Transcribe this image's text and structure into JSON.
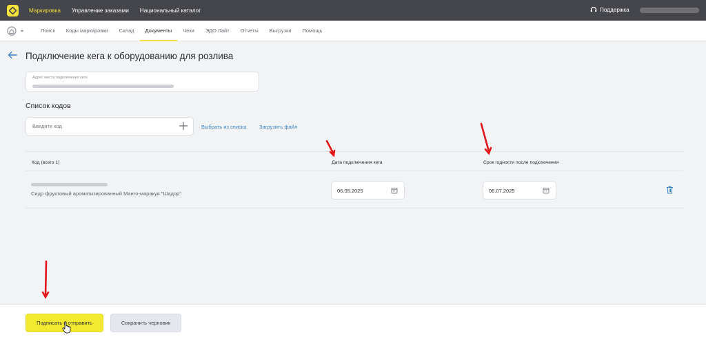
{
  "header": {
    "nav": [
      "Маркировка",
      "Управление заказами",
      "Национальный каталог"
    ],
    "support_label": "Поддержка"
  },
  "subnav": {
    "tabs": [
      "Поиск",
      "Коды маркировки",
      "Склад",
      "Документы",
      "Чеки",
      "ЭДО Лайт",
      "Отчеты",
      "Выгрузки",
      "Помощь"
    ],
    "active_tab": "Документы"
  },
  "page": {
    "title": "Подключение кега к оборудованию для розлива"
  },
  "address": {
    "label": "Адрес места подключения кега"
  },
  "codes": {
    "section_title": "Список кодов",
    "input_placeholder": "Введите код",
    "select_link": "Выбрать из списка",
    "upload_link": "Загрузить файл"
  },
  "table": {
    "columns": [
      "Код (всего 1)",
      "Дата подключения кега",
      "Срок годности после подключения"
    ],
    "rows": [
      {
        "product_name": "Сидр фруктовый ароматизированный Манго-маракуя \"Шадор\"",
        "connection_date": "06.05.2025",
        "expiry_date": "06.07.2025"
      }
    ]
  },
  "footer": {
    "submit_label": "Подписать и отправить",
    "draft_label": "Сохранить черновик"
  },
  "colors": {
    "accent": "#f2ea31",
    "topbar": "#45464b",
    "link": "#3b82c4",
    "annotation_arrow": "#e3161b"
  },
  "icons": [
    "logo-icon",
    "headset-icon",
    "home-icon",
    "back-arrow-icon",
    "plus-icon",
    "calendar-icon",
    "trash-icon",
    "hand-cursor-icon"
  ]
}
